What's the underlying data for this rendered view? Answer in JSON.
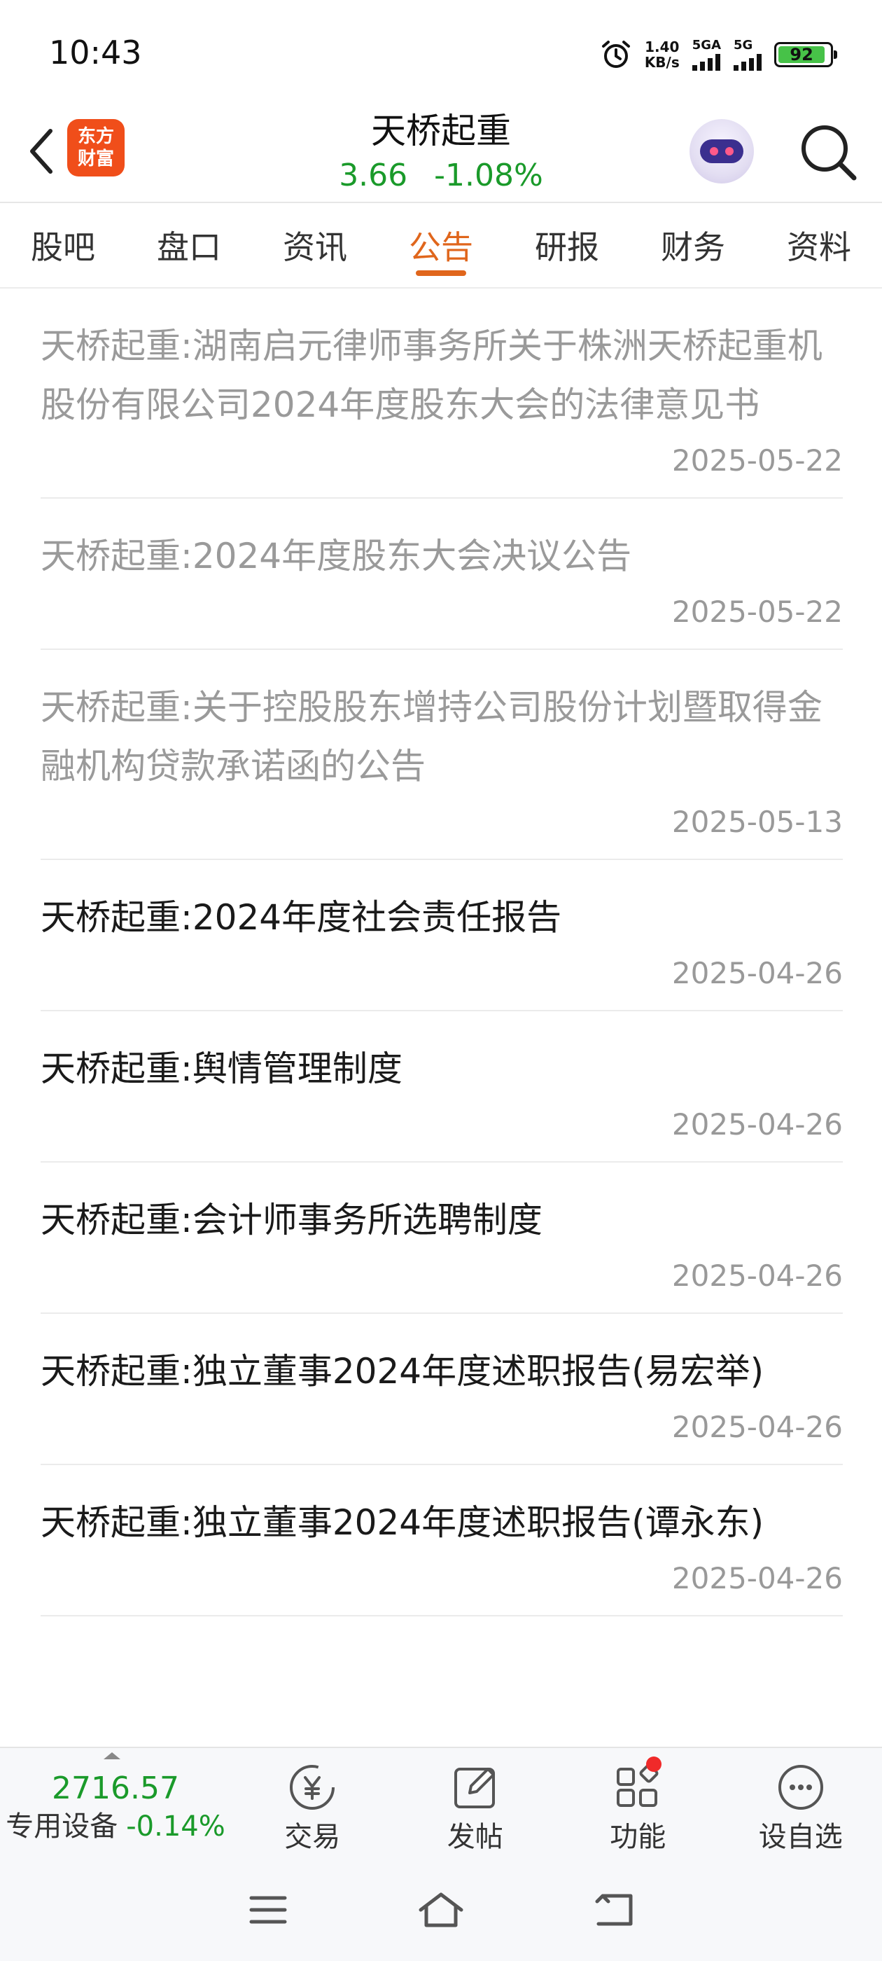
{
  "status_bar": {
    "time": "10:43",
    "net_speed_value": "1.40",
    "net_speed_unit": "KB/s",
    "sim1_label": "5GA",
    "sim2_label": "5G",
    "battery": "92"
  },
  "header": {
    "logo_line1": "东方",
    "logo_line2": "财富",
    "stock_name": "天桥起重",
    "price": "3.66",
    "change": "-1.08%"
  },
  "tabs": [
    {
      "label": "股吧"
    },
    {
      "label": "盘口"
    },
    {
      "label": "资讯"
    },
    {
      "label": "公告",
      "active": true
    },
    {
      "label": "研报"
    },
    {
      "label": "财务"
    },
    {
      "label": "资料"
    }
  ],
  "announcements": [
    {
      "title": "天桥起重:湖南启元律师事务所关于株洲天桥起重机股份有限公司2024年度股东大会的法律意见书",
      "date": "2025-05-22",
      "read": true
    },
    {
      "title": "天桥起重:2024年度股东大会决议公告",
      "date": "2025-05-22",
      "read": true
    },
    {
      "title": "天桥起重:关于控股股东增持公司股份计划暨取得金融机构贷款承诺函的公告",
      "date": "2025-05-13",
      "read": true
    },
    {
      "title": "天桥起重:2024年度社会责任报告",
      "date": "2025-04-26",
      "read": false
    },
    {
      "title": "天桥起重:舆情管理制度",
      "date": "2025-04-26",
      "read": false
    },
    {
      "title": "天桥起重:会计师事务所选聘制度",
      "date": "2025-04-26",
      "read": false
    },
    {
      "title": "天桥起重:独立董事2024年度述职报告(易宏举)",
      "date": "2025-04-26",
      "read": false
    },
    {
      "title": "天桥起重:独立董事2024年度述职报告(谭永东)",
      "date": "2025-04-26",
      "read": false
    }
  ],
  "toolbar": {
    "index_value": "2716.57",
    "index_name": "专用设备",
    "index_change": "-0.14%",
    "trade_label": "交易",
    "post_label": "发帖",
    "function_label": "功能",
    "watchlist_label": "设自选"
  },
  "colors": {
    "accent": "#e0661c",
    "down_green": "#1a9a2a",
    "read_gray": "#9a9a9a",
    "logo_orange": "#f04e1a"
  }
}
